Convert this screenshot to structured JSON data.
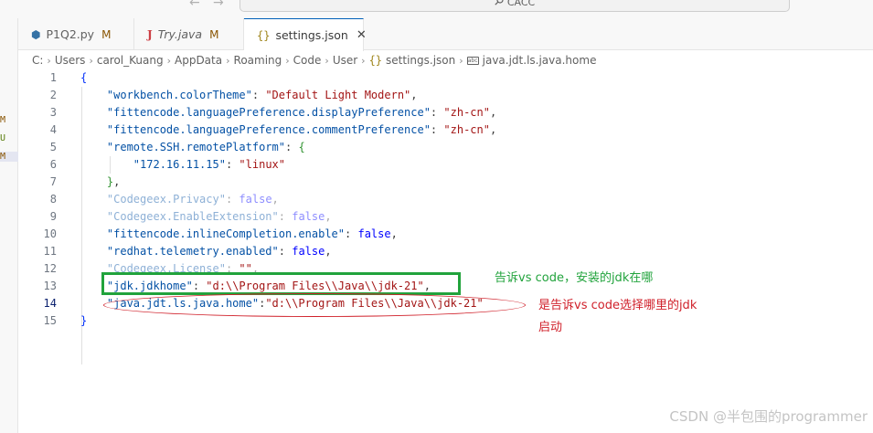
{
  "titlebar": {
    "back_arrow": "←",
    "forward_arrow": "→",
    "command_center_text": "CACC"
  },
  "sidebar": {
    "marks": [
      {
        "text": "M",
        "kind": "m"
      },
      {
        "text": "U",
        "kind": "u"
      },
      {
        "text": "M",
        "kind": "m"
      }
    ]
  },
  "tabs": [
    {
      "icon": "python-file-icon",
      "name": "P1Q2.py",
      "status": "M",
      "active": false,
      "italic": false
    },
    {
      "icon": "java-file-icon",
      "name": "Try.java",
      "status": "M",
      "active": false,
      "italic": true
    },
    {
      "icon": "json-file-icon",
      "name": "settings.json",
      "status": "",
      "active": true,
      "italic": false
    }
  ],
  "tab_icons": {
    "python": "⬢",
    "java": "J",
    "json": "{}",
    "close": "✕"
  },
  "breadcrumb": {
    "segments": [
      "C:",
      "Users",
      "carol_Kuang",
      "AppData",
      "Roaming",
      "Code",
      "User"
    ],
    "file": "settings.json",
    "key": "java.jdt.ls.java.home",
    "separator": "›",
    "file_icon": "{}",
    "key_icon": "abc"
  },
  "editor": {
    "current_line": 14,
    "lines": [
      {
        "n": "1",
        "code": "{"
      },
      {
        "n": "2",
        "code": "    \"workbench.colorTheme\": \"Default Light Modern\","
      },
      {
        "n": "3",
        "code": "    \"fittencode.languagePreference.displayPreference\": \"zh-cn\","
      },
      {
        "n": "4",
        "code": "    \"fittencode.languagePreference.commentPreference\": \"zh-cn\","
      },
      {
        "n": "5",
        "code": "    \"remote.SSH.remotePlatform\": {"
      },
      {
        "n": "6",
        "code": "        \"172.16.11.15\": \"linux\""
      },
      {
        "n": "7",
        "code": "    },"
      },
      {
        "n": "8",
        "code": "    \"Codegeex.Privacy\": false,"
      },
      {
        "n": "9",
        "code": "    \"Codegeex.EnableExtension\": false,"
      },
      {
        "n": "10",
        "code": "    \"fittencode.inlineCompletion.enable\": false,"
      },
      {
        "n": "11",
        "code": "    \"redhat.telemetry.enabled\": false,"
      },
      {
        "n": "12",
        "code": "    \"Codegeex.License\": \"\","
      },
      {
        "n": "13",
        "code": "    \"jdk.jdkhome\": \"d:\\\\Program Files\\\\Java\\\\jdk-21\","
      },
      {
        "n": "14",
        "code": "    \"java.jdt.ls.java.home\":\"d:\\\\Program Files\\\\Java\\\\jdk-21\""
      },
      {
        "n": "15",
        "code": "}"
      }
    ],
    "faded_lines": [
      8,
      9,
      12
    ]
  },
  "annotations": {
    "green_note": "告诉vs code，安装的jdk在哪",
    "red_note_line1": "是告诉vs code选择哪里的jdk",
    "red_note_line2": "启动"
  },
  "watermark": "CSDN @半包围的programmer"
}
